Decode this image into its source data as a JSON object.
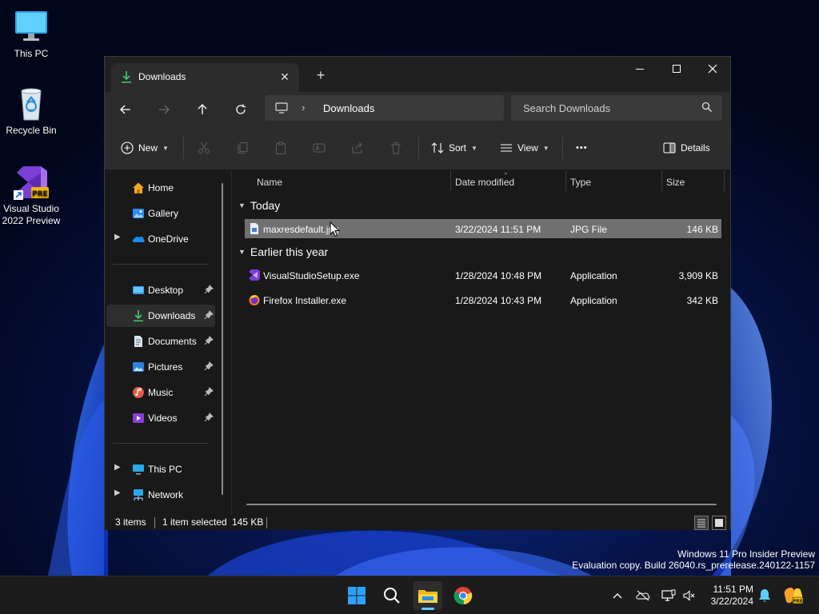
{
  "desktop": {
    "icons": [
      {
        "label": "This PC",
        "icon": "monitor-icon"
      },
      {
        "label": "Recycle Bin",
        "icon": "recycle-bin-icon"
      },
      {
        "label": "Visual Studio 2022 Preview",
        "icon": "visual-studio-icon",
        "badge": "PRE"
      }
    ],
    "watermark": {
      "line1": "Windows 11 Pro Insider Preview",
      "line2": "Evaluation copy. Build 26040.rs_prerelease.240122-1157"
    }
  },
  "window": {
    "tab": {
      "title": "Downloads",
      "icon": "download-icon"
    },
    "new_tab": "+",
    "controls": {
      "minimize": "minimize-icon",
      "maximize": "maximize-icon",
      "close": "close-icon"
    },
    "address": {
      "crumb": "Downloads",
      "root_icon": "monitor-icon"
    },
    "search": {
      "placeholder": "Search Downloads"
    },
    "toolbar": {
      "new_label": "New",
      "sort_label": "Sort",
      "view_label": "View",
      "more_label": "•••",
      "details_label": "Details"
    },
    "sidebar": {
      "home": "Home",
      "gallery": "Gallery",
      "onedrive": "OneDrive",
      "desktop": "Desktop",
      "downloads": "Downloads",
      "documents": "Documents",
      "pictures": "Pictures",
      "music": "Music",
      "videos": "Videos",
      "thispc": "This PC",
      "network": "Network"
    },
    "columns": {
      "name": "Name",
      "date": "Date modified",
      "type": "Type",
      "size": "Size"
    },
    "groups": {
      "today": "Today",
      "earlier": "Earlier this year"
    },
    "files": {
      "f1": {
        "name": "maxresdefault.jpg",
        "date": "3/22/2024 11:51 PM",
        "type": "JPG File",
        "size": "146 KB",
        "icon": "image-file-icon"
      },
      "f2": {
        "name": "VisualStudioSetup.exe",
        "date": "1/28/2024 10:48 PM",
        "type": "Application",
        "size": "3,909 KB",
        "icon": "visual-studio-icon"
      },
      "f3": {
        "name": "Firefox Installer.exe",
        "date": "1/28/2024 10:43 PM",
        "type": "Application",
        "size": "342 KB",
        "icon": "firefox-icon"
      }
    },
    "status": {
      "items": "3 items",
      "selected": "1 item selected",
      "size": "145 KB"
    }
  },
  "taskbar": {
    "apps": [
      "start-icon",
      "search-icon",
      "file-explorer-icon",
      "chrome-icon"
    ],
    "tray": [
      "chevron-up-icon",
      "onedrive-icon",
      "network-icon",
      "volume-icon",
      "notification-bell-icon",
      "copilot-icon"
    ],
    "clock": {
      "time": "11:51 PM",
      "date": "3/22/2024"
    }
  },
  "colors": {
    "accent": "#60cdff",
    "window_bg": "#191919",
    "selected_row": "#707070",
    "taskbar_bg": "#1c1c1c"
  }
}
